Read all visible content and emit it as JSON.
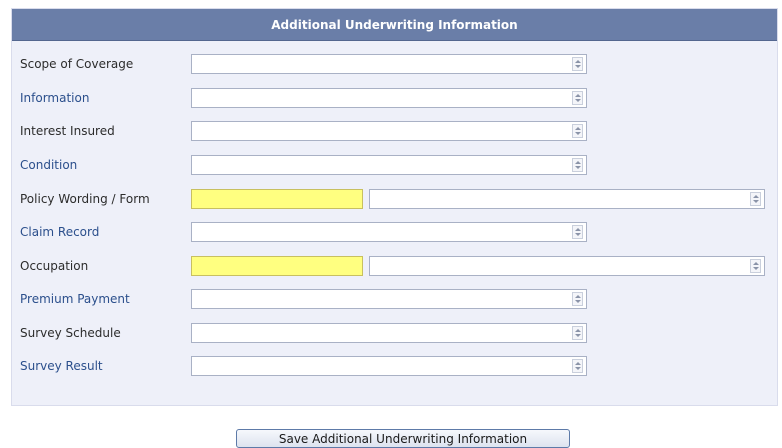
{
  "panel": {
    "title": "Additional Underwriting Information"
  },
  "fields": {
    "scope_of_coverage": {
      "label": "Scope of Coverage",
      "value": ""
    },
    "information": {
      "label": "Information",
      "value": ""
    },
    "interest_insured": {
      "label": "Interest Insured",
      "value": ""
    },
    "condition": {
      "label": "Condition",
      "value": ""
    },
    "policy_wording": {
      "label": "Policy Wording / Form",
      "code": "",
      "value": ""
    },
    "claim_record": {
      "label": "Claim Record",
      "value": ""
    },
    "occupation": {
      "label": "Occupation",
      "code": "",
      "value": ""
    },
    "premium_payment": {
      "label": "Premium Payment",
      "value": ""
    },
    "survey_schedule": {
      "label": "Survey Schedule",
      "value": ""
    },
    "survey_result": {
      "label": "Survey Result",
      "value": ""
    }
  },
  "actions": {
    "save_label": "Save Additional Underwriting Information"
  },
  "colors": {
    "header_bg": "#6a7ea8",
    "panel_bg": "#eef0f9",
    "highlight_field": "#ffff80",
    "blue_label": "#2b4f8c"
  }
}
